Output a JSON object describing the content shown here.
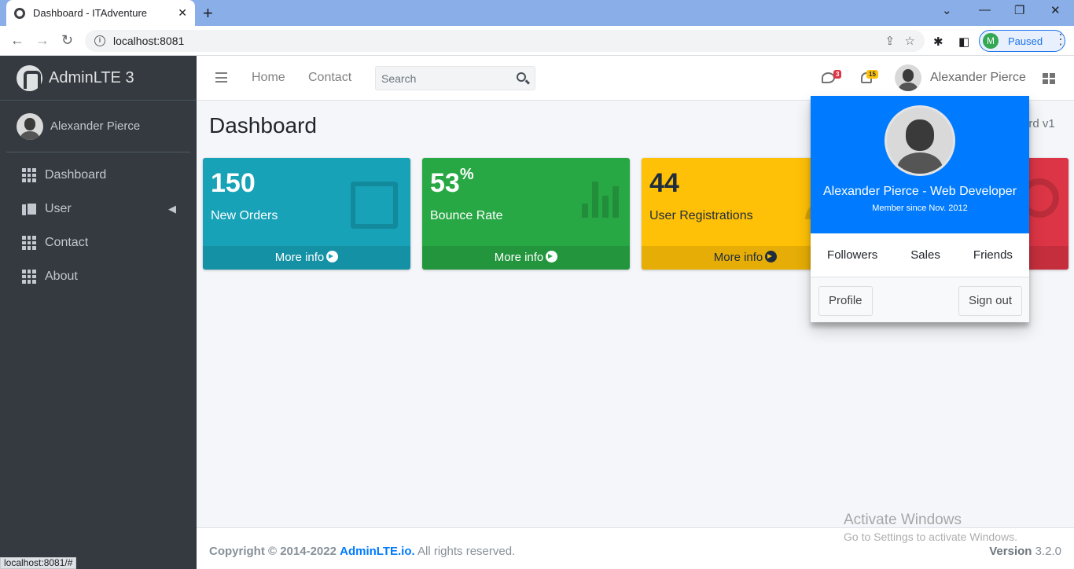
{
  "browser": {
    "tab_title": "Dashboard - ITAdventure",
    "url": "localhost:8081",
    "profile_initial": "M",
    "profile_status": "Paused",
    "status_url": "localhost:8081/#"
  },
  "sidebar": {
    "brand": "AdminLTE 3",
    "user_name": "Alexander Pierce",
    "items": [
      {
        "label": "Dashboard",
        "icon": "grid-icon"
      },
      {
        "label": "User",
        "icon": "copy-icon"
      },
      {
        "label": "Contact",
        "icon": "grid-icon"
      },
      {
        "label": "About",
        "icon": "grid-icon"
      }
    ]
  },
  "navbar": {
    "links": [
      "Home",
      "Contact"
    ],
    "search_placeholder": "Search",
    "messages_count": "3",
    "notifications_count": "15",
    "user_name": "Alexander Pierce"
  },
  "content": {
    "title": "Dashboard",
    "breadcrumb_partial": "ard v1",
    "boxes": [
      {
        "value": "150",
        "suffix": "",
        "label": "New Orders",
        "more": "More info",
        "color": "#17a2b8"
      },
      {
        "value": "53",
        "suffix": "%",
        "label": "Bounce Rate",
        "more": "More info",
        "color": "#28a745"
      },
      {
        "value": "44",
        "suffix": "",
        "label": "User Registrations",
        "more": "More info",
        "color": "#ffc107"
      },
      {
        "color": "#dc3545"
      }
    ]
  },
  "user_dropdown": {
    "title": "Alexander Pierce - Web Developer",
    "subtitle": "Member since Nov. 2012",
    "links": [
      "Followers",
      "Sales",
      "Friends"
    ],
    "profile_button": "Profile",
    "signout_button": "Sign out",
    "header_color": "#007bff"
  },
  "footer": {
    "copyright_prefix": "Copyright © 2014-2022",
    "brand_link": "AdminLTE.io.",
    "rights": "All rights reserved.",
    "version_label": "Version",
    "version_number": "3.2.0"
  },
  "watermark": {
    "line1": "Activate Windows",
    "line2": "Go to Settings to activate Windows."
  }
}
